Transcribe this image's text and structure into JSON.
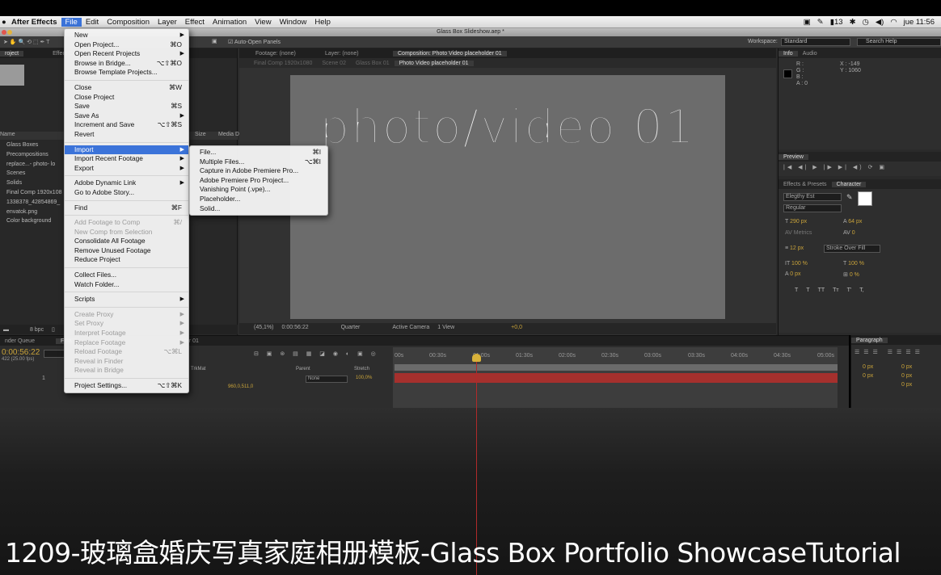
{
  "menubar": {
    "app": "After Effects",
    "items": [
      "File",
      "Edit",
      "Composition",
      "Layer",
      "Effect",
      "Animation",
      "View",
      "Window",
      "Help"
    ],
    "right": {
      "wifi_level": "13",
      "time": "jue 11:56"
    }
  },
  "window": {
    "title": "Glass Box Slideshow.aep *"
  },
  "toolbar": {
    "auto_open": "Auto-Open Panels",
    "workspace_label": "Workspace:",
    "workspace_value": "Standard",
    "search": "Search Help"
  },
  "project_panel": {
    "tabs": [
      "roject",
      "Effect Co"
    ],
    "col_name": "Name",
    "col_size": "Size",
    "col_media": "Media D",
    "items": [
      "Glass Boxes",
      "Precompositions",
      "replace...- photo- lo",
      "Scenes",
      "Solids",
      "Final Comp 1920x108",
      "1338378_42854869_",
      "envatok.png",
      "Color background"
    ],
    "bpc": "8 bpc"
  },
  "comp_panel": {
    "tabs": [
      "Footage: (none)",
      "Layer: (none)",
      "Composition: Photo Video placeholder 01"
    ],
    "breadcrumbs": [
      "Final Comp 1920x1080",
      "Scene 02",
      "Glass Box 01",
      "Photo Video placeholder 01"
    ],
    "viewer_text": "photo/video 01",
    "bottom": {
      "zoom": "(45,1%)",
      "timecode": "0:00:56:22",
      "resolution": "Quarter",
      "camera": "Active Camera",
      "views": "1 View",
      "exposure": "+0,0"
    }
  },
  "info_panel": {
    "tabs": [
      "Info",
      "Audio"
    ],
    "r": "R :",
    "g": "G :",
    "b": "B :",
    "a": "A : 0",
    "x": "X : -149",
    "y": "Y : 1060"
  },
  "preview_panel": {
    "tab": "Preview"
  },
  "character_panel": {
    "tabs": [
      "Effects & Presets",
      "Character"
    ],
    "font": "Elegthy Est",
    "style": "Regular",
    "size": "290 px",
    "leading": "64 px",
    "kerning": "Metrics",
    "tracking": "0",
    "stroke_width": "12 px",
    "stroke_mode": "Stroke Over Fill",
    "vscale": "100 %",
    "hscale": "100 %",
    "baseline": "0 px",
    "tsume": "0 %",
    "type_buttons": [
      "T",
      "T",
      "TT",
      "Tт",
      "T'",
      "T,"
    ]
  },
  "timeline": {
    "tabs": [
      "nder Queue",
      "Fina",
      "older 01"
    ],
    "timecode": "0:00:56:22",
    "fps": "422 (25.00 fps)",
    "col_trkmat": "TrkMat",
    "col_parent": "Parent",
    "col_stretch": "Stretch",
    "layer_num": "1",
    "parent_value": "None",
    "stretch_value": "100,0%",
    "position_value": "960,0,511,0",
    "ruler": [
      "00s",
      "00:30s",
      "01:00s",
      "01:30s",
      "02:00s",
      "02:30s",
      "03:00s",
      "03:30s",
      "04:00s",
      "04:30s",
      "05:00s"
    ]
  },
  "paragraph_panel": {
    "tab": "Paragraph",
    "values": [
      "0 px",
      "0 px",
      "0 px",
      "0 px",
      "0 px"
    ]
  },
  "file_menu": {
    "items": [
      {
        "label": "New",
        "arrow": true
      },
      {
        "label": "Open Project...",
        "sc": "⌘O"
      },
      {
        "label": "Open Recent Projects",
        "arrow": true
      },
      {
        "label": "Browse in Bridge...",
        "sc": "⌥⇧⌘O"
      },
      {
        "label": "Browse Template Projects..."
      },
      {
        "sep": true
      },
      {
        "label": "Close",
        "sc": "⌘W"
      },
      {
        "label": "Close Project"
      },
      {
        "label": "Save",
        "sc": "⌘S"
      },
      {
        "label": "Save As",
        "arrow": true
      },
      {
        "label": "Increment and Save",
        "sc": "⌥⇧⌘S"
      },
      {
        "label": "Revert"
      },
      {
        "sep": true
      },
      {
        "label": "Import",
        "arrow": true,
        "hl": true
      },
      {
        "label": "Import Recent Footage",
        "arrow": true
      },
      {
        "label": "Export",
        "arrow": true
      },
      {
        "sep": true
      },
      {
        "label": "Adobe Dynamic Link",
        "arrow": true
      },
      {
        "label": "Go to Adobe Story..."
      },
      {
        "sep": true
      },
      {
        "label": "Find",
        "sc": "⌘F"
      },
      {
        "sep": true
      },
      {
        "label": "Add Footage to Comp",
        "sc": "⌘/",
        "dis": true
      },
      {
        "label": "New Comp from Selection",
        "dis": true
      },
      {
        "label": "Consolidate All Footage"
      },
      {
        "label": "Remove Unused Footage"
      },
      {
        "label": "Reduce Project"
      },
      {
        "sep": true
      },
      {
        "label": "Collect Files..."
      },
      {
        "label": "Watch Folder..."
      },
      {
        "sep": true
      },
      {
        "label": "Scripts",
        "arrow": true
      },
      {
        "sep": true
      },
      {
        "label": "Create Proxy",
        "arrow": true,
        "dis": true
      },
      {
        "label": "Set Proxy",
        "arrow": true,
        "dis": true
      },
      {
        "label": "Interpret Footage",
        "arrow": true,
        "dis": true
      },
      {
        "label": "Replace Footage",
        "arrow": true,
        "dis": true
      },
      {
        "label": "Reload Footage",
        "sc": "⌥⌘L",
        "dis": true
      },
      {
        "label": "Reveal in Finder",
        "dis": true
      },
      {
        "label": "Reveal in Bridge",
        "dis": true
      },
      {
        "sep": true
      },
      {
        "label": "Project Settings...",
        "sc": "⌥⇧⌘K"
      }
    ]
  },
  "import_menu": {
    "items": [
      {
        "label": "File...",
        "sc": "⌘I"
      },
      {
        "label": "Multiple Files...",
        "sc": "⌥⌘I"
      },
      {
        "label": "Capture in Adobe Premiere Pro..."
      },
      {
        "label": "Adobe Premiere Pro Project..."
      },
      {
        "label": "Vanishing Point (.vpe)..."
      },
      {
        "label": "Placeholder..."
      },
      {
        "label": "Solid..."
      }
    ]
  },
  "caption": "1209-玻璃盒婚庆写真家庭相册模板-Glass Box Portfolio ShowcaseTutorial"
}
